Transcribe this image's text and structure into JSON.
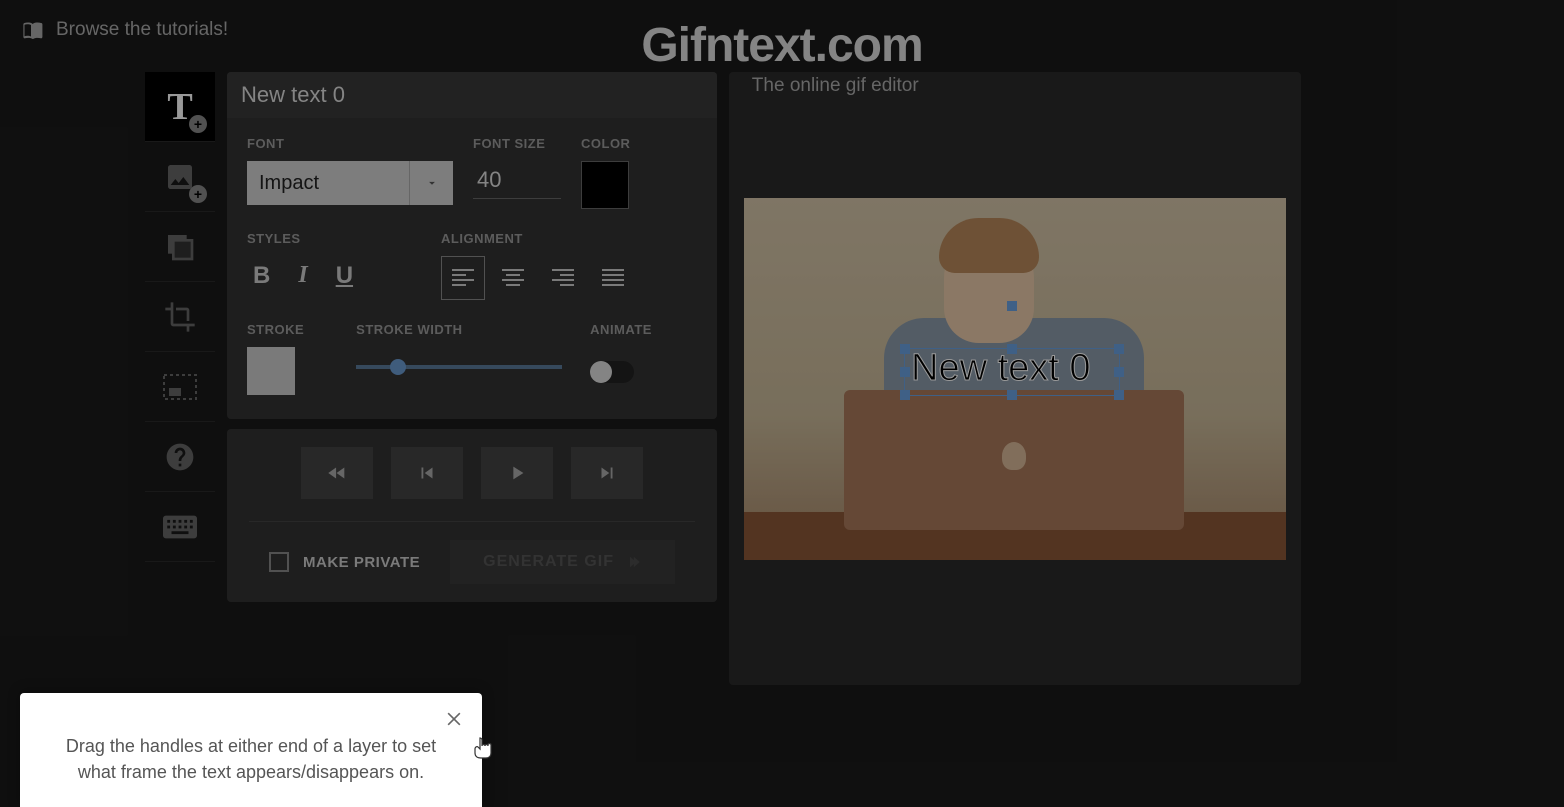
{
  "header": {
    "tutorials_link": "Browse the tutorials!",
    "title": "Gifntext.com",
    "tagline": "The online gif editor"
  },
  "sidebar": {
    "items": [
      {
        "name": "add-text",
        "icon": "text"
      },
      {
        "name": "add-image",
        "icon": "image"
      },
      {
        "name": "layers",
        "icon": "layers"
      },
      {
        "name": "crop",
        "icon": "crop"
      },
      {
        "name": "resize",
        "icon": "resize"
      },
      {
        "name": "help",
        "icon": "help"
      },
      {
        "name": "keyboard",
        "icon": "keyboard"
      }
    ]
  },
  "text_panel": {
    "title": "New text 0",
    "labels": {
      "font": "FONT",
      "font_size": "FONT SIZE",
      "color": "COLOR",
      "styles": "STYLES",
      "alignment": "ALIGNMENT",
      "stroke": "STROKE",
      "stroke_width": "STROKE WIDTH",
      "animate": "ANIMATE"
    },
    "font": "Impact",
    "font_size": "40",
    "color": "#000000",
    "stroke_color": "#cccccc",
    "animate": false,
    "alignment_selected": "left"
  },
  "controls": {
    "make_private": "MAKE PRIVATE",
    "generate": "GENERATE GIF"
  },
  "canvas": {
    "text_overlay": "New text 0"
  },
  "tooltip": {
    "text": "Drag the handles at either end of a layer to set what frame the text appears/disappears on."
  }
}
